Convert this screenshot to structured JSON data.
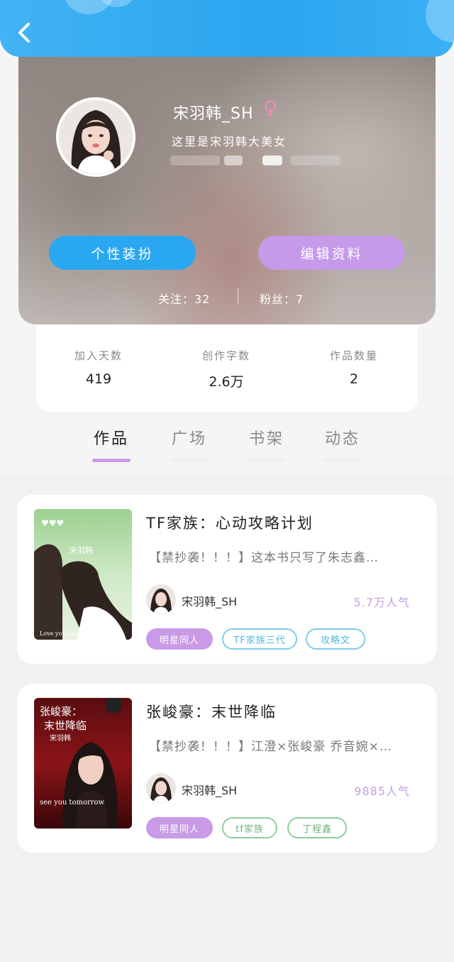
{
  "profile": {
    "username": "宋羽韩_SH",
    "gender_symbol": "♀",
    "bio": "这里是宋羽韩大美女",
    "buttons": {
      "dress_up": "个性装扮",
      "edit_profile": "编辑资料"
    },
    "following": "关注：32",
    "followers": "粉丝：7"
  },
  "stats": [
    {
      "label": "加入天数",
      "value": "419"
    },
    {
      "label": "创作字数",
      "value": "2.6万"
    },
    {
      "label": "作品数量",
      "value": "2"
    }
  ],
  "tabs": [
    {
      "label": "作品",
      "active": true
    },
    {
      "label": "广场",
      "active": false
    },
    {
      "label": "书架",
      "active": false
    },
    {
      "label": "动态",
      "active": false
    }
  ],
  "works": [
    {
      "title": "TF家族：心动攻略计划",
      "description": "【禁抄袭！！！】这本书只写了朱志鑫…",
      "author": "宋羽韩_SH",
      "popularity": "5.7万人气",
      "tags": [
        "明星同人",
        "TF家族三代",
        "攻略文"
      ],
      "cover_text": {
        "name": "宋羽韩",
        "caption": "Love you like the wind"
      }
    },
    {
      "title": "张峻豪：末世降临",
      "description": "【禁抄袭！！！】江澄×张峻豪 乔音婉×…",
      "author": "宋羽韩_SH",
      "popularity": "9885人气",
      "tags": [
        "明星同人",
        "tf家族",
        "丁程鑫"
      ],
      "cover_text": {
        "title_line1": "张峻豪：",
        "title_line2": "末世降临",
        "name": "宋羽韩",
        "caption": "see you tomorrow"
      }
    }
  ],
  "colors": {
    "header_blue": "#2aa5ef",
    "accent_purple": "#c99ae6",
    "tag_blue": "#4db8de",
    "tag_green": "#6fb37e"
  }
}
